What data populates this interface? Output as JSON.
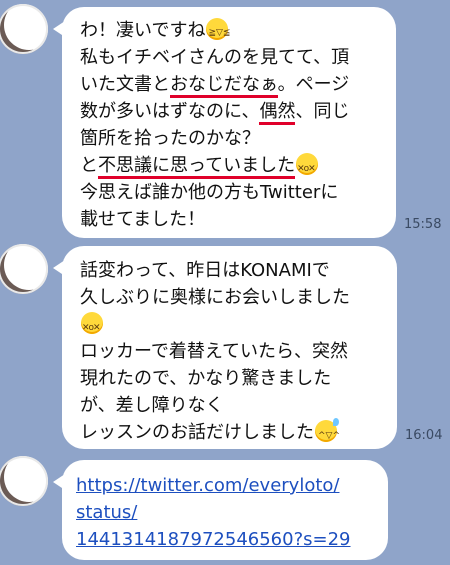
{
  "messages": [
    {
      "time": "15:58",
      "lines": [
        {
          "text": "わ！凄いですね",
          "emoji": "grinning-squinting-face"
        },
        {
          "text": "私もイチベイさんのを見てて、頂"
        },
        {
          "pre": "いた文書と",
          "under": "おなじだなぁ",
          "post": "。ページ"
        },
        {
          "pre": "数が多いはずなのに、",
          "under": "偶然",
          "post": "、同じ"
        },
        {
          "text": "箇所を拾ったのかな？"
        },
        {
          "pre": "と",
          "under": "不思議に思っていました",
          "emoji": "dizzy-face"
        },
        {
          "text": "今思えば誰か他の方もTwitterに"
        },
        {
          "text": "載せてました！"
        }
      ]
    },
    {
      "time": "16:04",
      "lines": [
        {
          "text": "話変わって、昨日はKONAMIで"
        },
        {
          "text": "久しぶりに奥様にお会いしました"
        },
        {
          "text": "",
          "emoji": "dizzy-face"
        },
        {
          "text": "ロッカーで着替えていたら、突然"
        },
        {
          "text": "現れたので、かなり驚きました"
        },
        {
          "text": "が、差し障りなく"
        },
        {
          "text": "レッスンのお話だけしました",
          "emoji": "grinning-sweat-face"
        }
      ]
    },
    {
      "lines": [
        {
          "text": "https://twitter.com/everyloto/"
        },
        {
          "text": "status/"
        },
        {
          "text": "1441314187972546560?s=29"
        }
      ]
    }
  ],
  "colors": {
    "background": "#8fa4c9",
    "bubble": "#ffffff",
    "underline": "#e0002a",
    "link": "#1d4fbf"
  }
}
